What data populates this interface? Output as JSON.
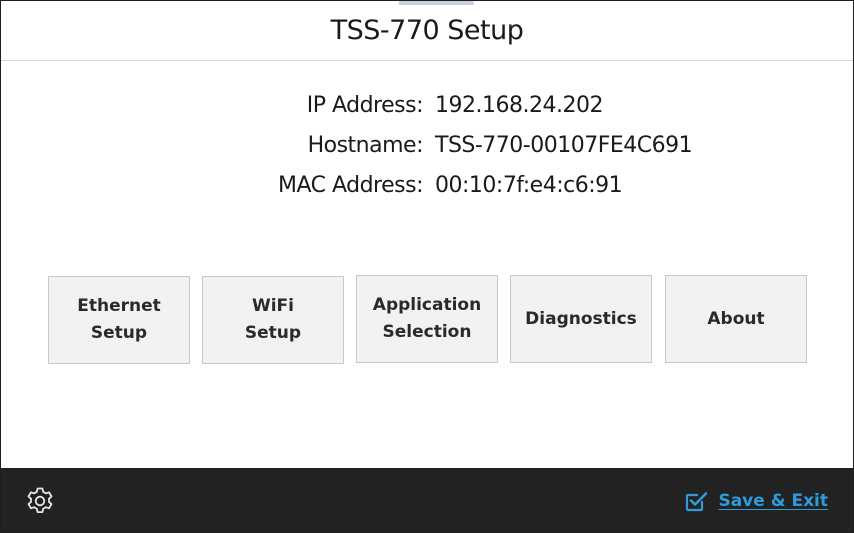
{
  "header": {
    "title": "TSS-770 Setup"
  },
  "info": {
    "rows": [
      {
        "label": "IP Address:",
        "value": "192.168.24.202"
      },
      {
        "label": "Hostname:",
        "value": "TSS-770-00107FE4C691"
      },
      {
        "label": "MAC Address:",
        "value": "00:10:7f:e4:c6:91"
      }
    ]
  },
  "buttons": [
    {
      "label": "Ethernet\nSetup"
    },
    {
      "label": "WiFi\nSetup"
    },
    {
      "label": "Application\nSelection"
    },
    {
      "label": "Diagnostics"
    },
    {
      "label": "About"
    }
  ],
  "footer": {
    "settings_icon": "gear-icon",
    "save_icon": "checkbox-checked-icon",
    "save_label": "Save & Exit"
  },
  "colors": {
    "footer_bg": "#222222",
    "accent": "#2f9bdc",
    "button_bg": "#f2f2f2"
  }
}
